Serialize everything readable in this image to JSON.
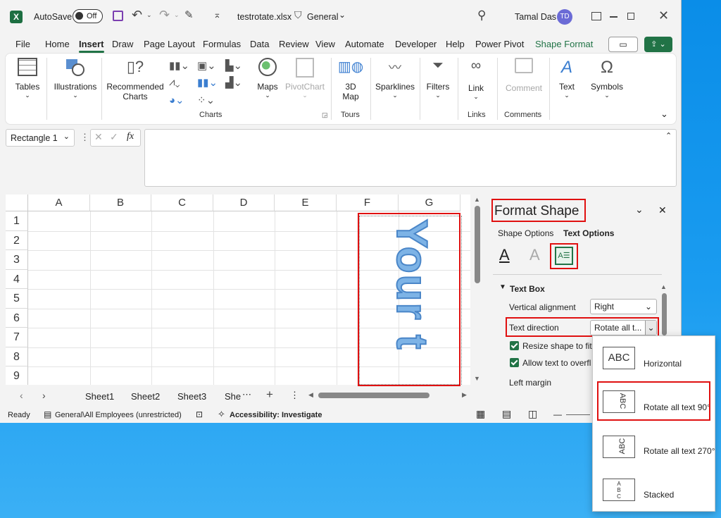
{
  "titlebar": {
    "autosave": "AutoSave",
    "toggle": "Off",
    "filename": "testrotate.xlsx",
    "sensitivity": "General",
    "user": "Tamal Das",
    "initials": "TD"
  },
  "tabs": [
    "File",
    "Home",
    "Insert",
    "Draw",
    "Page Layout",
    "Formulas",
    "Data",
    "Review",
    "View",
    "Automate",
    "Developer",
    "Help",
    "Power Pivot",
    "Shape Format"
  ],
  "ribbon": {
    "tables": "Tables",
    "illustrations": "Illustrations",
    "recommended1": "Recommended",
    "recommended2": "Charts",
    "maps": "Maps",
    "pivotchart": "PivotChart",
    "map3d1": "3D",
    "map3d2": "Map",
    "sparklines": "Sparklines",
    "filters": "Filters",
    "link": "Link",
    "comment": "Comment",
    "text": "Text",
    "symbols": "Symbols",
    "group_charts": "Charts",
    "group_tours": "Tours",
    "group_links": "Links",
    "group_comments": "Comments"
  },
  "formula": {
    "namebox": "Rectangle 1",
    "fx": "fx"
  },
  "grid": {
    "columns": [
      "A",
      "B",
      "C",
      "D",
      "E",
      "F",
      "G"
    ],
    "rows": [
      "1",
      "2",
      "3",
      "4",
      "5",
      "6",
      "7",
      "8",
      "9"
    ],
    "shape_text": "Your t"
  },
  "sheets": [
    "Sheet1",
    "Sheet2",
    "Sheet3",
    "She"
  ],
  "pane": {
    "title": "Format Shape",
    "tab_shape": "Shape Options",
    "tab_text": "Text Options",
    "section": "Text Box",
    "valign_label": "Vertical alignment",
    "valign_value": "Right",
    "textdir_label": "Text direction",
    "textdir_value": "Rotate all t...",
    "resize_label": "Resize shape to fit t",
    "overflow_label": "Allow text to overfl",
    "left_margin": "Left margin"
  },
  "menu": {
    "items": [
      {
        "icon": "ABC",
        "label": "Horizontal"
      },
      {
        "icon": "ABC",
        "label": "Rotate all text 90°"
      },
      {
        "icon": "ABC",
        "label": "Rotate all text 270°"
      },
      {
        "icon": "A B C",
        "label": "Stacked"
      }
    ]
  },
  "status": {
    "ready": "Ready",
    "label": "General\\All Employees (unrestricted)",
    "accessibility": "Accessibility: Investigate"
  },
  "colors": {
    "excel_green": "#217346",
    "shape_blue": "#6aa4d8",
    "highlight_red": "#e01010",
    "accent_purple": "#6b6bd6"
  }
}
